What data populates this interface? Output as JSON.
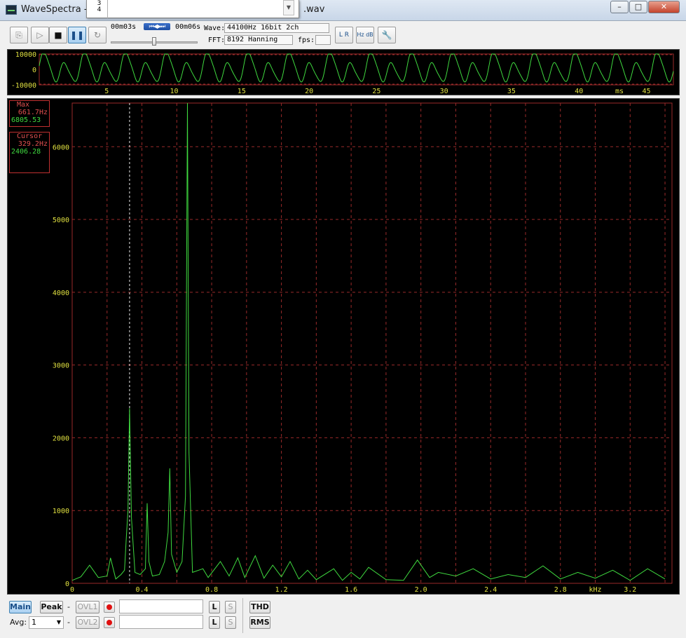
{
  "window": {
    "title_left": "WaveSpectra - D",
    "title_right": ".wav",
    "controls": {
      "minimize": "–",
      "maximize": "□",
      "close": "✕"
    }
  },
  "dropdown": {
    "items": [
      "3",
      "4"
    ],
    "scroll_arrow": "▼"
  },
  "toolbar": {
    "time_start": "00m03s",
    "time_end": "00m06s",
    "transport_glyph": "⏮◀▶⏭",
    "wave_label": "Wave:",
    "wave_value": "44100Hz 16bit 2ch",
    "fft_label": "FFT:",
    "fft_value": "8192 Hanning",
    "fps_label": "fps:",
    "fps_value": "",
    "slider_position_pct": 49,
    "buttons": {
      "open": "⎘",
      "play_marker": "▷",
      "stop": "■",
      "pause": "❚❚",
      "reload": "↻",
      "lr": "L R",
      "hzdb": "Hz dB",
      "settings": "🔧"
    }
  },
  "waveform": {
    "y_ticks": [
      "10000",
      "0",
      "-10000"
    ],
    "x_ticks": [
      "5",
      "10",
      "15",
      "20",
      "25",
      "30",
      "35",
      "40",
      "45"
    ],
    "x_unit": "ms"
  },
  "spectrum": {
    "max_box": {
      "label": "Max",
      "freq": "661.7Hz",
      "value": "6805.53"
    },
    "cursor_box": {
      "label": "Cursor",
      "freq": "329.2Hz",
      "value": "2406.28"
    },
    "y_ticks": [
      "0",
      "1000",
      "2000",
      "3000",
      "4000",
      "5000",
      "6000"
    ],
    "x_ticks": [
      "0",
      "0.4",
      "0.8",
      "1.2",
      "1.6",
      "2.0",
      "2.4",
      "2.8",
      "3.2"
    ],
    "x_unit": "kHz"
  },
  "chart_data": {
    "type": "line",
    "title": "",
    "xlabel": "kHz",
    "ylabel": "",
    "xlim": [
      0,
      3.44
    ],
    "ylim": [
      0,
      6600
    ],
    "grid": true,
    "series": [
      {
        "x": [
          0.0,
          0.05,
          0.1,
          0.15,
          0.2,
          0.22,
          0.25,
          0.28,
          0.3,
          0.31,
          0.32,
          0.329,
          0.34,
          0.36,
          0.39,
          0.42,
          0.43,
          0.44,
          0.46,
          0.5,
          0.53,
          0.55,
          0.56,
          0.57,
          0.6,
          0.63,
          0.65,
          0.661,
          0.67,
          0.69,
          0.75,
          0.78,
          0.85,
          0.9,
          0.95,
          0.99,
          1.05,
          1.1,
          1.15,
          1.2,
          1.25,
          1.3,
          1.35,
          1.4,
          1.5,
          1.55,
          1.6,
          1.65,
          1.7,
          1.8,
          1.9,
          1.98,
          2.05,
          2.1,
          2.2,
          2.3,
          2.4,
          2.5,
          2.6,
          2.7,
          2.8,
          2.9,
          3.0,
          3.1,
          3.2,
          3.3,
          3.4
        ],
        "y": [
          40,
          90,
          250,
          80,
          100,
          350,
          60,
          120,
          180,
          600,
          1000,
          2406,
          900,
          150,
          120,
          200,
          1100,
          300,
          100,
          120,
          300,
          700,
          1580,
          400,
          150,
          300,
          1200,
          6600,
          1800,
          150,
          200,
          80,
          300,
          100,
          350,
          80,
          380,
          70,
          250,
          90,
          300,
          60,
          180,
          50,
          200,
          40,
          150,
          60,
          220,
          50,
          40,
          320,
          80,
          150,
          100,
          200,
          60,
          120,
          80,
          240,
          60,
          150,
          70,
          180,
          40,
          200,
          60
        ]
      }
    ]
  },
  "bottom": {
    "main": "Main",
    "peak": "Peak",
    "dash1": "-",
    "dash2": "-",
    "ovl1": "OVL1",
    "ovl2": "OVL2",
    "l1": "L",
    "s1": "S",
    "l2": "L",
    "s2": "S",
    "thd": "THD",
    "rms": "RMS",
    "avg_label": "Avg:",
    "avg_value": "1"
  },
  "colors": {
    "trace": "#3fd93f",
    "grid": "#9a2a2a",
    "axis_text": "#e0e040",
    "background": "#000000"
  }
}
